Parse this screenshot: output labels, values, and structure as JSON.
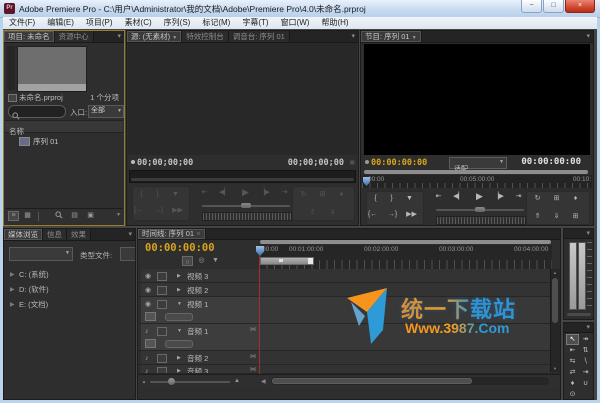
{
  "colors": {
    "accent_orange": "#d9a51c",
    "focus_border": "#9a7e2b",
    "aero_blue": "#b9d3ea",
    "watermark_orange": "#f7941d",
    "watermark_blue": "#2e9bd6"
  },
  "window": {
    "title": "Adobe Premiere Pro - C:\\用户\\Administrator\\我的文档\\Adobe\\Premiere Pro\\4.0\\未命名.prproj",
    "icon_text": "Pr",
    "minimize": "−",
    "maximize": "□",
    "close": "×"
  },
  "menu_bar": {
    "items": [
      "文件(F)",
      "编辑(E)",
      "项目(P)",
      "素材(C)",
      "序列(S)",
      "标记(M)",
      "字幕(T)",
      "窗口(W)",
      "帮助(H)"
    ]
  },
  "icons": {
    "menu": "▾",
    "dropdown": "▼",
    "close": "×",
    "eye": "◉",
    "speaker": "♪",
    "expand": "▶",
    "collapse": "▼",
    "list_view": "≡",
    "icon_view": "▦",
    "bin": "▤",
    "new_item": "▣",
    "snap": "∩",
    "encore_marker": "◎",
    "marker": "▼",
    "track_output": "⋈",
    "scroll_up": "▲",
    "scroll_down": "▼",
    "scroll_left": "◀",
    "zoom_out": "▲",
    "zoom_in": "▲",
    "gang": "▣"
  },
  "project_panel": {
    "tabs": [
      {
        "label": "项目: 未命名"
      },
      {
        "label": "资源中心"
      }
    ],
    "file_name": "未命名.prproj",
    "item_count": "1 个分项",
    "entry_label": "入口:",
    "entry_value": "全部",
    "name_column": "名称",
    "items": [
      {
        "label": "序列 01"
      }
    ]
  },
  "source_panel": {
    "tabs": [
      {
        "label": "源: (无素材)"
      },
      {
        "label": "特效控制台"
      },
      {
        "label": "调音台: 序列 01"
      }
    ],
    "timecode_left": "00;00;00;00",
    "timecode_right": "00;00;00;00"
  },
  "program_panel": {
    "tab": "节目: 序列 01",
    "timecode_left": "00:00:00:00",
    "fit_value": "适配",
    "timecode_right": "00:00:00:00",
    "ruler_ticks": [
      "00:00",
      "00:05:00:00",
      "00:10:"
    ]
  },
  "media_panel": {
    "tabs": [
      {
        "label": "媒体浏览"
      },
      {
        "label": "信息"
      },
      {
        "label": "效果"
      }
    ],
    "file_type_label": "类型文件:",
    "drives": [
      {
        "label": "C: (系统)"
      },
      {
        "label": "D: (软件)"
      },
      {
        "label": "E: (文档)"
      }
    ]
  },
  "timeline_panel": {
    "tab": "时间线: 序列 01",
    "timecode": "00:00:00:00",
    "ruler_ticks": [
      "00:00",
      "00:01:00:00",
      "00:02:00:00",
      "00:03:00:00",
      "00:04:00:00"
    ],
    "tracks": [
      {
        "label": "视频 3"
      },
      {
        "label": "视频 2"
      },
      {
        "label": "视频 1"
      },
      {
        "label": "音频 1"
      },
      {
        "label": "音频 2"
      },
      {
        "label": "音频 3"
      }
    ]
  },
  "transport": {
    "set_in": "{",
    "set_out": "}",
    "marker": "▼",
    "goto_in": "⇤",
    "step_back": "◀▏",
    "play": "▶",
    "step_forward": "▕▶",
    "goto_out": "⇥",
    "loop": "↻",
    "safe_margins": "⊞",
    "output": "♦",
    "goto_in_btn": "{←",
    "goto_out_btn": "→}",
    "play_in_out": "▶▶",
    "lift": "⇑",
    "extract": "⇓",
    "trim": "⊞"
  },
  "tools": {
    "items": [
      {
        "name": "selection",
        "glyph": "↖"
      },
      {
        "name": "track-select",
        "glyph": "↠"
      },
      {
        "name": "ripple-edit",
        "glyph": "⇤"
      },
      {
        "name": "rolling-edit",
        "glyph": "⇅"
      },
      {
        "name": "rate-stretch",
        "glyph": "⇆"
      },
      {
        "name": "razor",
        "glyph": "∖"
      },
      {
        "name": "slip",
        "glyph": "⇄"
      },
      {
        "name": "slide",
        "glyph": "⇥"
      },
      {
        "name": "pen",
        "glyph": "♦"
      },
      {
        "name": "hand",
        "glyph": "∪"
      },
      {
        "name": "zoom",
        "glyph": "⊙"
      }
    ]
  },
  "watermark": {
    "line1": "统一下载站",
    "line2": "Www.3987.Com"
  }
}
